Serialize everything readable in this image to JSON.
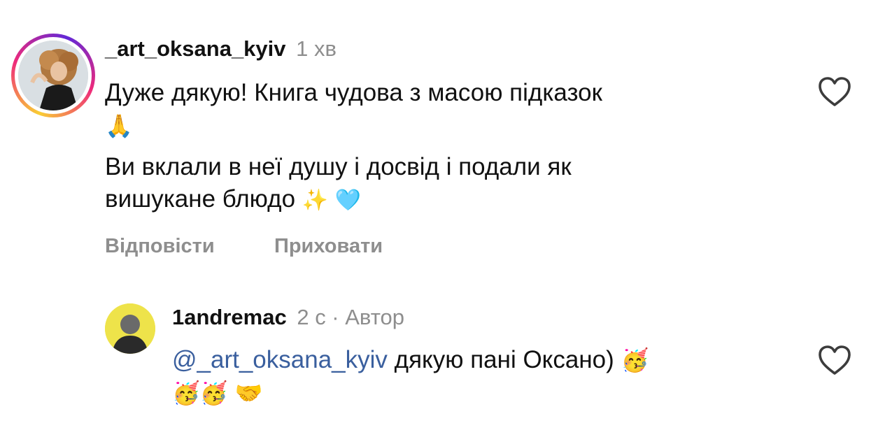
{
  "comments": [
    {
      "username": "_art_oksana_kyiv",
      "time": "1 хв",
      "text_line1": "Дуже дякую! Книга чудова з масою підказок",
      "text_line1_emoji": "🙏",
      "text_line2": "Ви вклали в неї душу і досвід і подали як",
      "text_line3": "вишукане блюдо",
      "text_line3_emoji": "✨ 🩵",
      "reply_label": "Відповісти",
      "hide_label": "Приховати",
      "like_icon": "heart-outline-icon"
    },
    {
      "username": "1andremac",
      "time": "2 с · Автор",
      "mention": "@_art_oksana_kyiv",
      "text_line1": " дякую пані Оксано)",
      "text_line1_emoji": "🥳",
      "text_line2_emoji": "🥳🥳 🤝",
      "like_icon": "heart-outline-icon"
    }
  ],
  "colors": {
    "meta_gray": "#8e8e8e",
    "mention_blue": "#3a5f9e",
    "story_ring": [
      "#f9ce34",
      "#ee2a7b",
      "#6228d7"
    ]
  }
}
